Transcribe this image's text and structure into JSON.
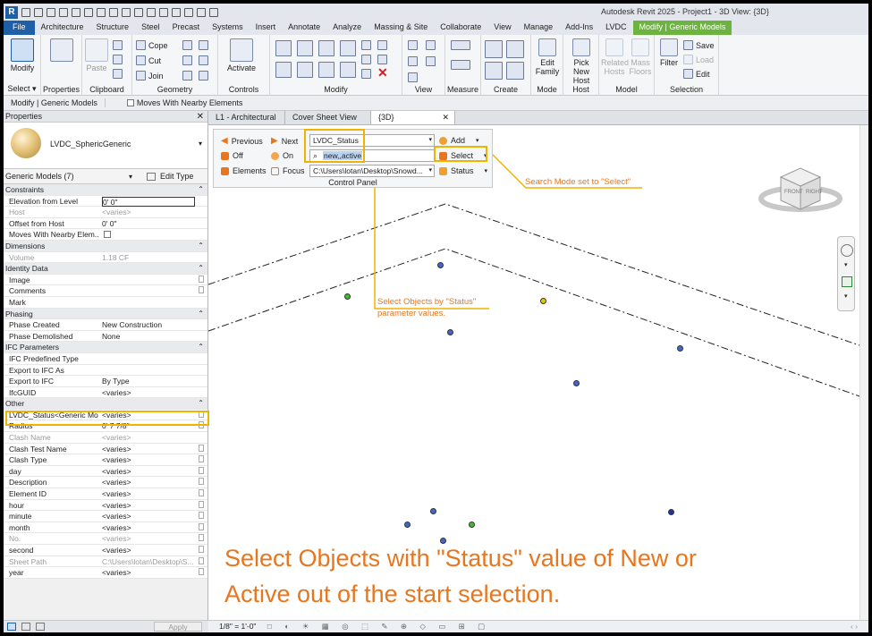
{
  "window": {
    "title": "Autodesk Revit 2025 - Project1 - 3D View: {3D}",
    "app_badge": "R"
  },
  "ribbon_tabs": [
    "File",
    "Architecture",
    "Structure",
    "Steel",
    "Precast",
    "Systems",
    "Insert",
    "Annotate",
    "Analyze",
    "Massing & Site",
    "Collaborate",
    "View",
    "Manage",
    "Add-Ins",
    "LVDC",
    "Modify | Generic Models"
  ],
  "ribbon": {
    "select": {
      "modify": "Modify",
      "label": "Select ▾"
    },
    "properties": {
      "label": "Properties"
    },
    "clipboard": {
      "paste": "Paste",
      "label": "Clipboard"
    },
    "geometry": {
      "cope": "Cope",
      "cut": "Cut",
      "join": "Join",
      "label": "Geometry"
    },
    "controls": {
      "activate": "Activate",
      "label": "Controls"
    },
    "modify": {
      "label": "Modify"
    },
    "view": {
      "label": "View"
    },
    "measure": {
      "label": "Measure"
    },
    "create": {
      "label": "Create"
    },
    "mode": {
      "edit": "Edit",
      "family": "Family",
      "label": "Mode"
    },
    "host": {
      "pick": "Pick",
      "newhost": "New Host",
      "label": "Host"
    },
    "model": {
      "related": "Related",
      "hosts": "Hosts",
      "mass": "Mass",
      "floors": "Floors",
      "label": "Model"
    },
    "selection": {
      "filter": "Filter",
      "save": "Save",
      "load": "Load",
      "edit": "Edit",
      "label": "Selection"
    }
  },
  "options_bar": {
    "context": "Modify | Generic Models",
    "checkbox": "Moves With Nearby Elements"
  },
  "properties": {
    "title": "Properties",
    "type_name": "LVDC_SphericGeneric",
    "filter": "Generic Models (7)",
    "edit_type": "Edit Type",
    "apply": "Apply",
    "rows": [
      {
        "k": "Constraints",
        "cat": true
      },
      {
        "k": "Elevation from Level",
        "v": "0'  0\""
      },
      {
        "k": "Host",
        "v": "<varies>",
        "gray": true
      },
      {
        "k": "Offset from Host",
        "v": "0'  0\""
      },
      {
        "k": "Moves With Nearby Elem...",
        "v": ""
      },
      {
        "k": "Dimensions",
        "cat": true
      },
      {
        "k": "Volume",
        "v": "1.18 CF",
        "gray": true
      },
      {
        "k": "Identity Data",
        "cat": true
      },
      {
        "k": "Image",
        "v": ""
      },
      {
        "k": "Comments",
        "v": ""
      },
      {
        "k": "Mark",
        "v": ""
      },
      {
        "k": "Phasing",
        "cat": true
      },
      {
        "k": "Phase Created",
        "v": "New Construction"
      },
      {
        "k": "Phase Demolished",
        "v": "None"
      },
      {
        "k": "IFC Parameters",
        "cat": true
      },
      {
        "k": "IFC Predefined Type",
        "v": ""
      },
      {
        "k": "Export to IFC As",
        "v": ""
      },
      {
        "k": "Export to IFC",
        "v": "By Type"
      },
      {
        "k": "IfcGUID",
        "v": "<varies>"
      },
      {
        "k": "Other",
        "cat": true
      },
      {
        "k": "LVDC_Status<Generic Mo...",
        "v": "<varies>"
      },
      {
        "k": "Radius",
        "v": "0'  7 7/8\""
      },
      {
        "k": "Clash Name",
        "v": "<varies>",
        "gray": true
      },
      {
        "k": "Clash Test Name",
        "v": "<varies>"
      },
      {
        "k": "Clash Type",
        "v": "<varies>"
      },
      {
        "k": "day",
        "v": "<varies>"
      },
      {
        "k": "Description",
        "v": "<varies>"
      },
      {
        "k": "Element ID",
        "v": "<varies>"
      },
      {
        "k": "hour",
        "v": "<varies>"
      },
      {
        "k": "minute",
        "v": "<varies>"
      },
      {
        "k": "month",
        "v": "<varies>"
      },
      {
        "k": "No.",
        "v": "<varies>",
        "gray": true
      },
      {
        "k": "second",
        "v": "<varies>"
      },
      {
        "k": "Sheet Path",
        "v": "C:\\Users\\lotan\\Desktop\\S...",
        "gray": true
      },
      {
        "k": "year",
        "v": "<varies>"
      }
    ]
  },
  "view_tabs": [
    "L1 - Architectural",
    "Cover Sheet View",
    "{3D}"
  ],
  "control_panel": {
    "title": "Control Panel",
    "previous": "Previous",
    "next": "Next",
    "off": "Off",
    "on": "On",
    "elements": "Elements",
    "focus": "Focus",
    "param": "LVDC_Status",
    "search_value": "new,,active",
    "path": "C:\\Users\\lotan\\Desktop\\Snowd...",
    "add": "Add",
    "select": "Select",
    "status": "Status"
  },
  "viewcube": {
    "front": "FRONT",
    "right": "RIGHT"
  },
  "callouts": {
    "search_mode": "Search Mode set to \"Select\"",
    "select_objects_1": "Select Objects by \"Status\"",
    "select_objects_2": "parameter values.",
    "caption_1": "Select Objects with \"Status\" value of New or",
    "caption_2": "Active out of the start selection."
  },
  "status_bar": {
    "scale": "1/8\" = 1'-0\""
  },
  "colors": {
    "accent": "#1f5fa8",
    "context_tab": "#6db33f",
    "highlight": "#f0b400",
    "callout": "#e8761e"
  }
}
